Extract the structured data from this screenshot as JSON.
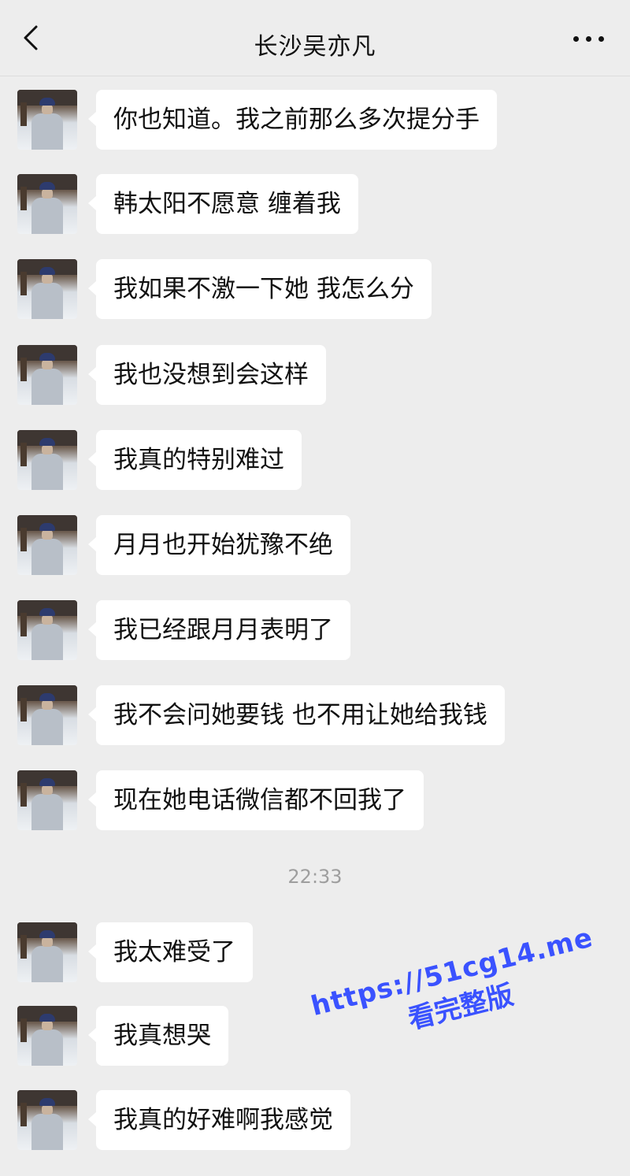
{
  "header": {
    "title": "长沙吴亦凡",
    "back_icon": "chevron-left-icon",
    "more_icon": "more-dots-icon"
  },
  "messages": [
    {
      "text": "你也知道。我之前那么多次提分手"
    },
    {
      "text": "韩太阳不愿意 缠着我"
    },
    {
      "text": "我如果不激一下她 我怎么分"
    },
    {
      "text": "我也没想到会这样"
    },
    {
      "text": "我真的特别难过"
    },
    {
      "text": "月月也开始犹豫不绝"
    },
    {
      "text": "我已经跟月月表明了"
    },
    {
      "text": "我不会问她要钱 也不用让她给我钱"
    },
    {
      "text": "现在她电话微信都不回我了"
    },
    {
      "text": "我太难受了"
    },
    {
      "text": "我真想哭"
    },
    {
      "text": "我真的好难啊我感觉"
    }
  ],
  "timestamp": "22:33",
  "watermark": {
    "line1": "https://51cg14.me",
    "line2": "看完整版",
    "color": "#3a52ff"
  },
  "colors": {
    "background": "#ededed",
    "bubble": "#ffffff",
    "text": "#111111",
    "timestamp": "#9e9e9e"
  }
}
